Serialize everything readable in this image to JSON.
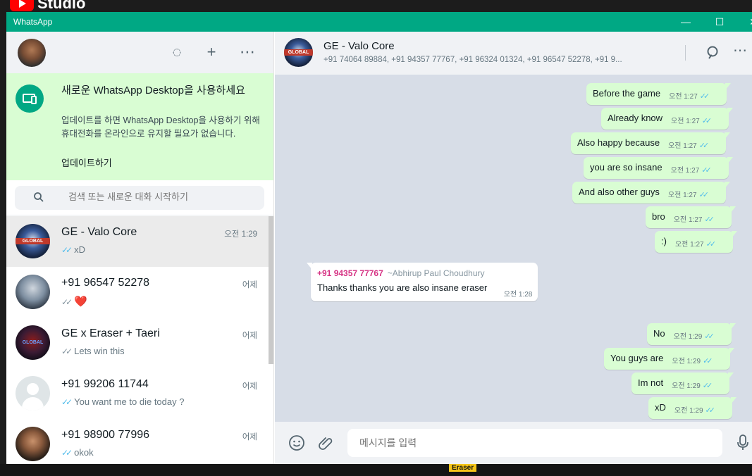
{
  "youtube": {
    "label": "Studio"
  },
  "window": {
    "title": "WhatsApp",
    "min": "—",
    "max": "☐",
    "close": "✕"
  },
  "left_header": {
    "status_icon": "◌",
    "new_chat_icon": "+",
    "menu_icon": "⋯"
  },
  "banner": {
    "title": "새로운 WhatsApp Desktop을 사용하세요",
    "text": "업데이트를 하면 WhatsApp Desktop을 사용하기 위해 휴대전화를 온라인으로 유지할 필요가 없습니다.",
    "link": "업데이트하기"
  },
  "search": {
    "placeholder": "검색 또는 새로운 대화 시작하기"
  },
  "chats": [
    {
      "name": "GE - Valo Core",
      "time": "오전 1:29",
      "ticks": "✓✓",
      "last": "xD"
    },
    {
      "name": "+91 96547 52278",
      "time": "어제",
      "ticks": "✓✓",
      "last": "❤️"
    },
    {
      "name": "GE x Eraser + Taeri",
      "time": "어제",
      "ticks": "✓✓",
      "last": "Lets win this"
    },
    {
      "name": "+91 99206 11744",
      "time": "어제",
      "ticks": "✓✓",
      "last": "You want me to die today ?"
    },
    {
      "name": "+91 98900 77996",
      "time": "어제",
      "ticks": "✓✓",
      "last": "okok"
    }
  ],
  "avatar_text": {
    "global": "GLOBAL"
  },
  "chat_header": {
    "title": "GE - Valo Core",
    "members": "+91 74064 89884, +91 94357 77767, +91 96324 01324, +91 96547 52278, +91 9..."
  },
  "messages_out_1": [
    {
      "text": "Before the game",
      "time": "오전 1:27",
      "ticks": "✓✓"
    },
    {
      "text": "Already know",
      "time": "오전 1:27",
      "ticks": "✓✓"
    },
    {
      "text": "Also happy because",
      "time": "오전 1:27",
      "ticks": "✓✓"
    },
    {
      "text": "you are so insane",
      "time": "오전 1:27",
      "ticks": "✓✓"
    },
    {
      "text": "And also other guys",
      "time": "오전 1:27",
      "ticks": "✓✓"
    },
    {
      "text": "bro",
      "time": "오전 1:27",
      "ticks": "✓✓"
    },
    {
      "text": ":)",
      "time": "오전 1:27",
      "ticks": "✓✓"
    }
  ],
  "message_in": {
    "sender": "+91 94357 77767",
    "alias": "~Abhirup Paul Choudhury",
    "text": "Thanks thanks you are also insane eraser",
    "time": "오전 1:28"
  },
  "messages_out_2": [
    {
      "text": "No",
      "time": "오전 1:29",
      "ticks": "✓✓"
    },
    {
      "text": "You guys are",
      "time": "오전 1:29",
      "ticks": "✓✓"
    },
    {
      "text": "Im not",
      "time": "오전 1:29",
      "ticks": "✓✓"
    },
    {
      "text": "xD",
      "time": "오전 1:29",
      "ticks": "✓✓"
    }
  ],
  "composer": {
    "placeholder": "메시지를 입력"
  },
  "overlay": {
    "eraser_tag": "Eraser"
  },
  "colors": {
    "brand": "#00a884",
    "bubble_out": "#d9fdd3",
    "chat_bg": "#d7dde7",
    "tick_blue": "#53bdeb"
  }
}
